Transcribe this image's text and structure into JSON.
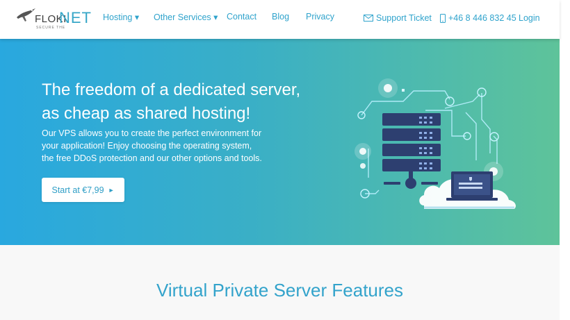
{
  "header": {
    "logo": {
      "name": "FLOKI",
      "suffix": "NET",
      "tagline": "SECURE THE"
    },
    "nav": [
      {
        "label": "Hosting ▾"
      },
      {
        "label": "Other Services ▾"
      },
      {
        "label": "Contact"
      },
      {
        "label": "Blog"
      },
      {
        "label": "Privacy"
      }
    ],
    "support_label": "Support Ticket",
    "phone": "+46 8 446 832 45",
    "login_label": "Login"
  },
  "hero": {
    "title_line1": "The freedom of a dedicated server,",
    "title_line2": "as cheap as shared hosting!",
    "text_line1": "Our VPS allows you to create the perfect environment for",
    "text_line2": "your application! Enjoy choosing the operating system,",
    "text_line3": "the free DDoS protection and our other options and tools.",
    "cta_label": "Start at €7,99",
    "cta_arrow": "►",
    "illustration": "server-cloud-laptop-illustration"
  },
  "features": {
    "title": "Virtual Private Server Features"
  },
  "colors": {
    "accent": "#2fa3cc",
    "hero_gradient_start": "#29a8df",
    "hero_gradient_end": "#5ec39a",
    "server_dark": "#2c3e6b"
  }
}
